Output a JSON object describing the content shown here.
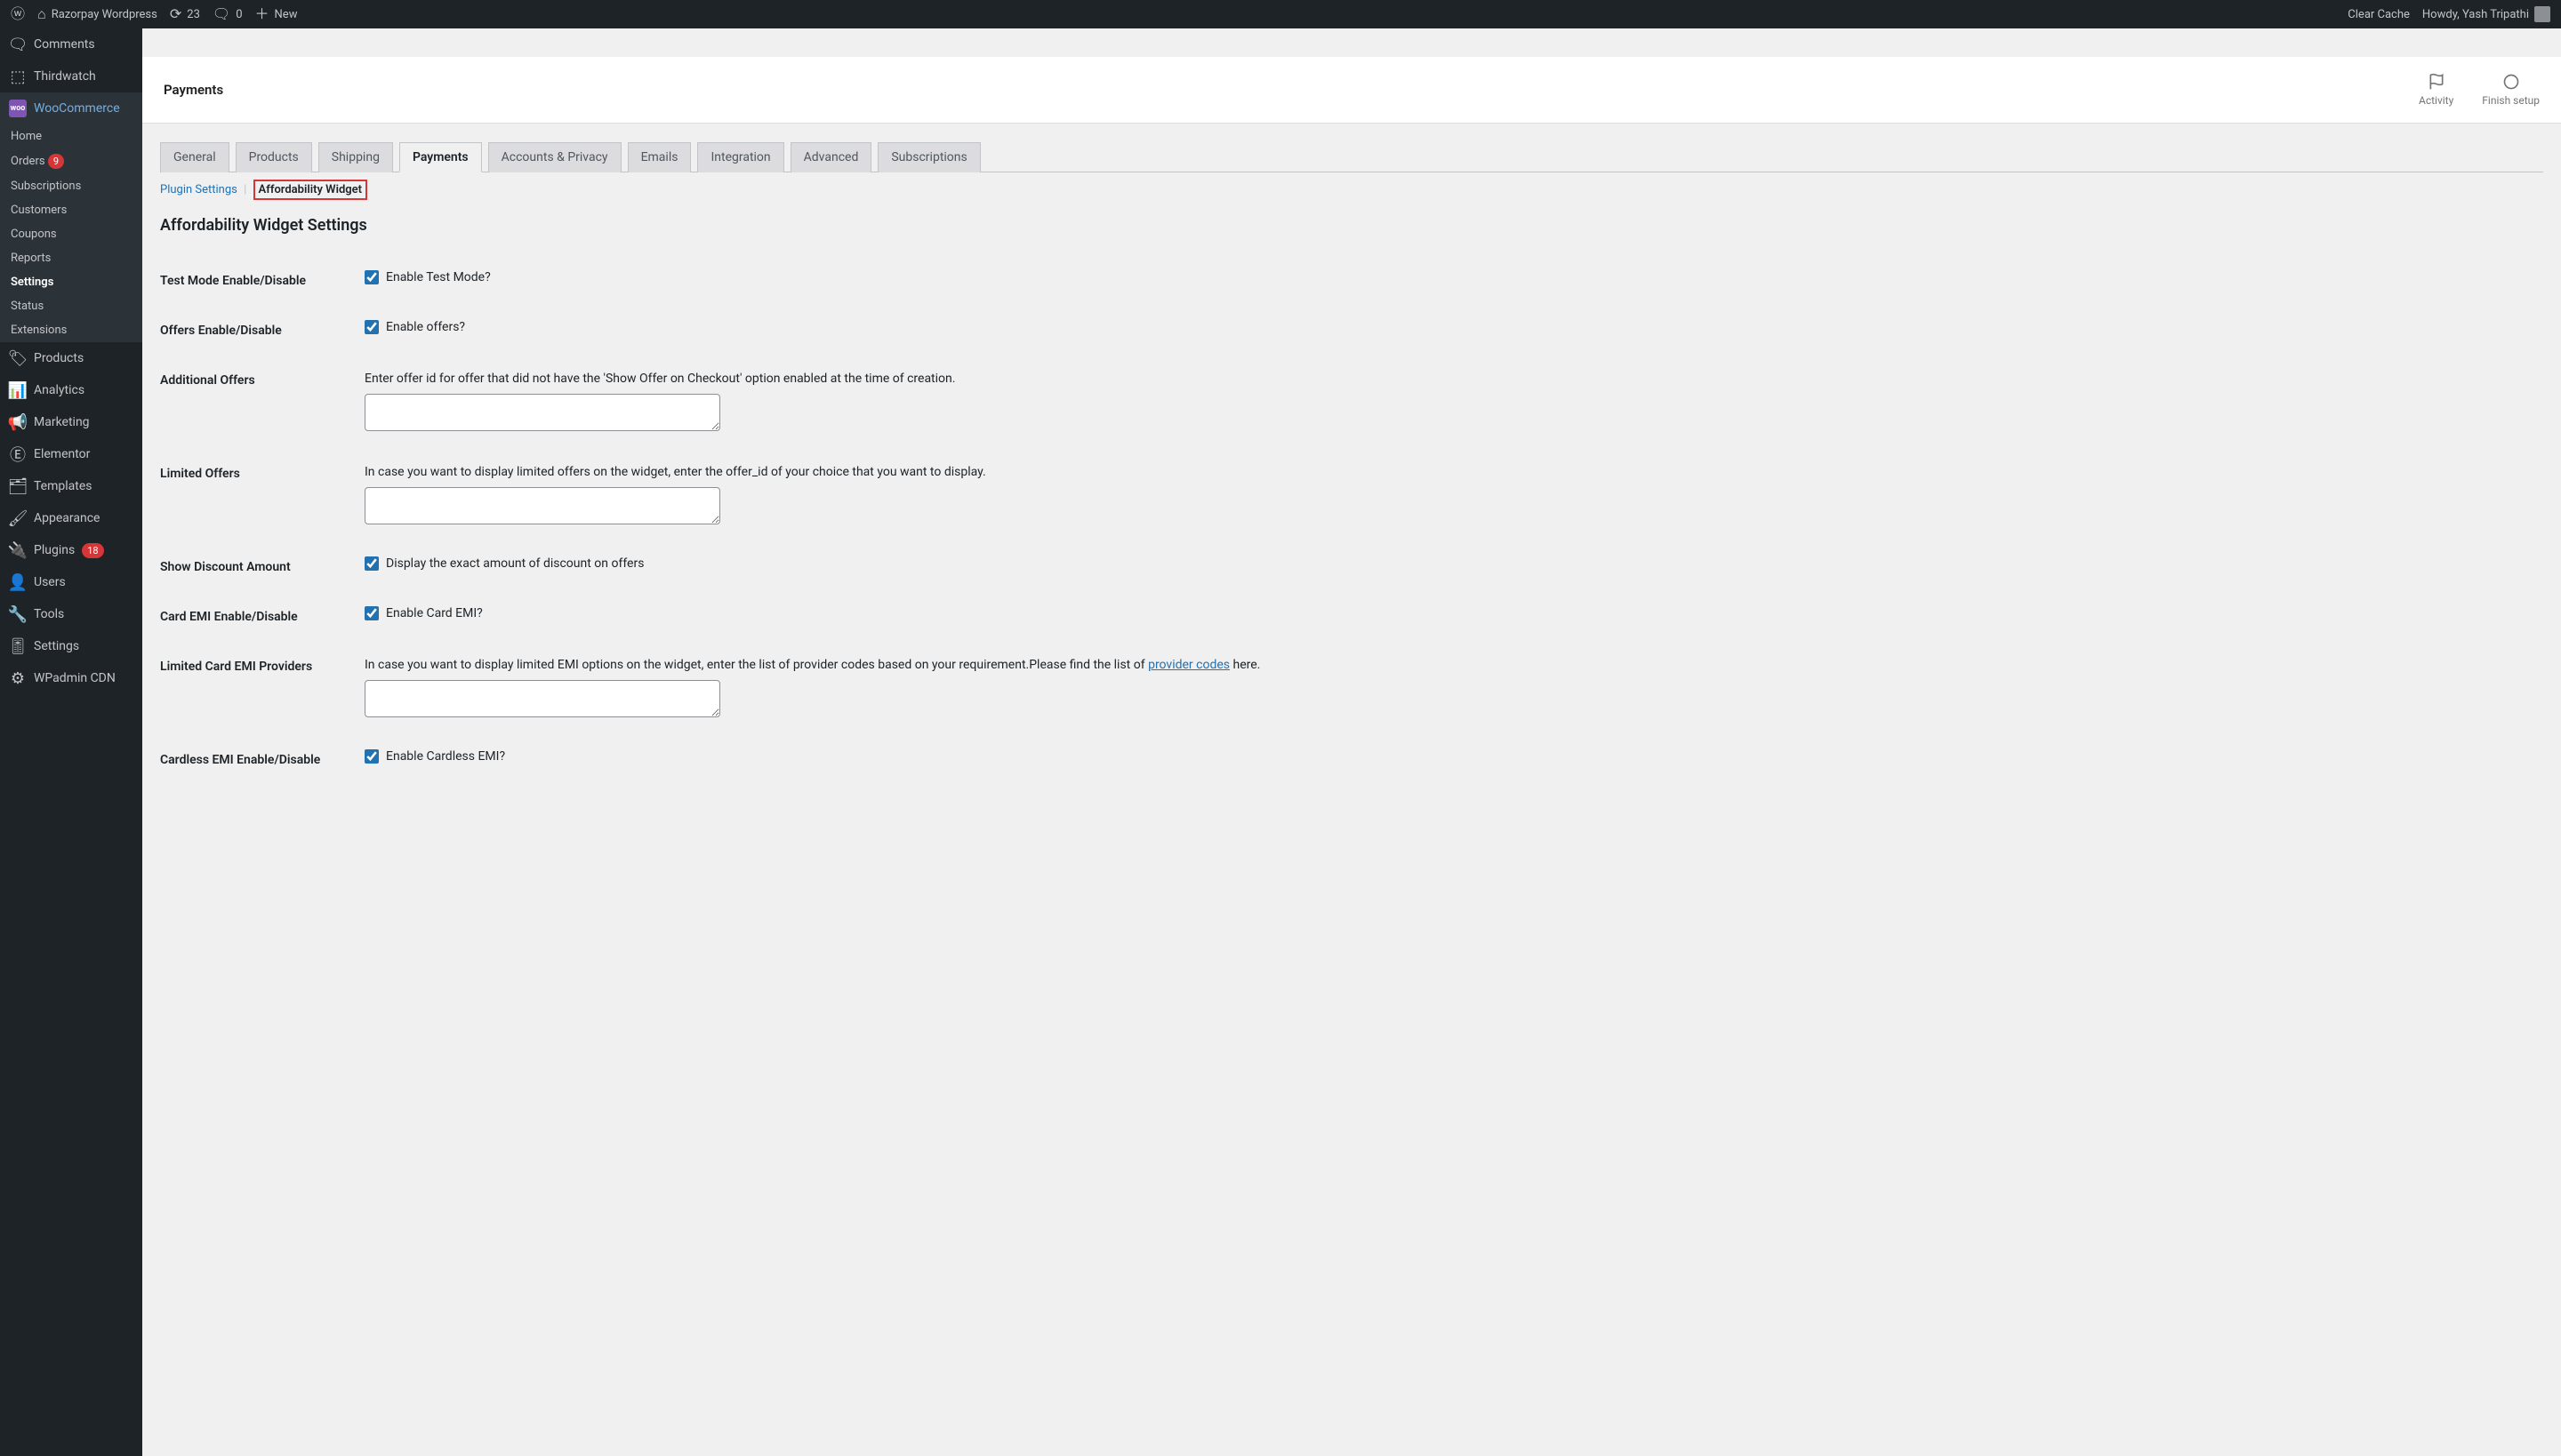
{
  "adminBar": {
    "siteName": "Razorpay Wordpress",
    "updates": "23",
    "comments": "0",
    "new": "New",
    "clearCache": "Clear Cache",
    "howdy": "Howdy, Yash Tripathi"
  },
  "sidebar": {
    "comments": "Comments",
    "thirdwatch": "Thirdwatch",
    "woocommerce": "WooCommerce",
    "submenu": {
      "home": "Home",
      "orders": "Orders",
      "ordersCount": "9",
      "subscriptions": "Subscriptions",
      "customers": "Customers",
      "coupons": "Coupons",
      "reports": "Reports",
      "settings": "Settings",
      "status": "Status",
      "extensions": "Extensions"
    },
    "products": "Products",
    "analytics": "Analytics",
    "marketing": "Marketing",
    "elementor": "Elementor",
    "templates": "Templates",
    "appearance": "Appearance",
    "plugins": "Plugins",
    "pluginsCount": "18",
    "users": "Users",
    "tools": "Tools",
    "settingsGlobal": "Settings",
    "wpadminCdn": "WPadmin CDN"
  },
  "header": {
    "title": "Payments",
    "activity": "Activity",
    "finishSetup": "Finish setup"
  },
  "tabs": {
    "general": "General",
    "products": "Products",
    "shipping": "Shipping",
    "payments": "Payments",
    "accounts": "Accounts & Privacy",
    "emails": "Emails",
    "integration": "Integration",
    "advanced": "Advanced",
    "subscriptions": "Subscriptions"
  },
  "subtabs": {
    "pluginSettings": "Plugin Settings",
    "affordabilityWidget": "Affordability Widget"
  },
  "settings": {
    "heading": "Affordability Widget Settings",
    "testMode": {
      "label": "Test Mode Enable/Disable",
      "checkbox": "Enable Test Mode?"
    },
    "offers": {
      "label": "Offers Enable/Disable",
      "checkbox": "Enable offers?"
    },
    "additionalOffers": {
      "label": "Additional Offers",
      "desc": "Enter offer id for offer that did not have the 'Show Offer on Checkout' option enabled at the time of creation."
    },
    "limitedOffers": {
      "label": "Limited Offers",
      "desc": "In case you want to display limited offers on the widget, enter the offer_id of your choice that you want to display."
    },
    "showDiscount": {
      "label": "Show Discount Amount",
      "checkbox": "Display the exact amount of discount on offers"
    },
    "cardEmi": {
      "label": "Card EMI Enable/Disable",
      "checkbox": "Enable Card EMI?"
    },
    "limitedCardEmi": {
      "label": "Limited Card EMI Providers",
      "desc1": "In case you want to display limited EMI options on the widget, enter the list of provider codes based on your requirement.Please find the list of ",
      "link": "provider codes",
      "desc2": " here."
    },
    "cardlessEmi": {
      "label": "Cardless EMI Enable/Disable",
      "checkbox": "Enable Cardless EMI?"
    }
  }
}
